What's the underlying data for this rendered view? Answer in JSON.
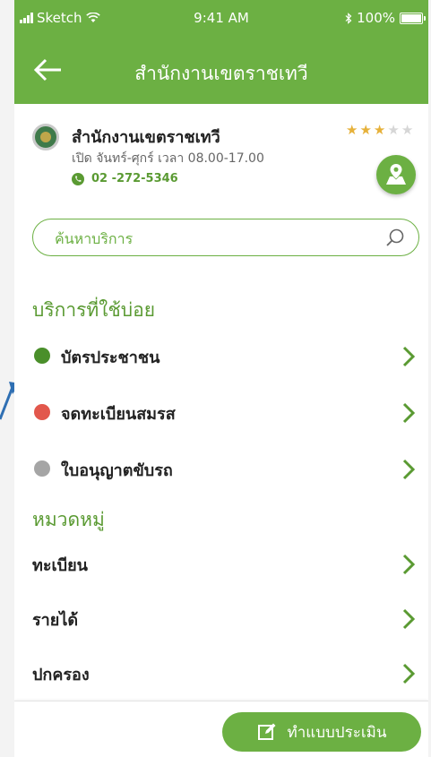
{
  "status": {
    "carrier": "Sketch",
    "time": "9:41 AM",
    "battery": "100%"
  },
  "nav": {
    "title": "สำนักงานเขตราชเทวี"
  },
  "office": {
    "name": "สำนักงานเขตราชเทวี",
    "hours": "เปิด จันทร์-ศุกร์ เวลา 08.00-17.00",
    "phone": "02 -272-5346",
    "rating": 3,
    "rating_max": 5
  },
  "search": {
    "placeholder": "ค้นหาบริการ"
  },
  "frequent": {
    "title": "บริการที่ใช้บ่อย",
    "items": [
      {
        "label": "บัตรประชาชน",
        "dot_color": "#4a8f2a"
      },
      {
        "label": "จดทะเบียนสมรส",
        "dot_color": "#e2574c"
      },
      {
        "label": "ใบอนุญาตขับรถ",
        "dot_color": "#a5a5a5"
      }
    ]
  },
  "categories": {
    "title": "หมวดหมู่",
    "items": [
      {
        "label": "ทะเบียน"
      },
      {
        "label": "รายได้"
      },
      {
        "label": "ปกครอง"
      }
    ]
  },
  "footer": {
    "evaluate_label": "ทำแบบประเมิน"
  },
  "colors": {
    "primary": "#6cb043",
    "accent_text": "#5a9a32",
    "chevron": "#5a9a32"
  }
}
